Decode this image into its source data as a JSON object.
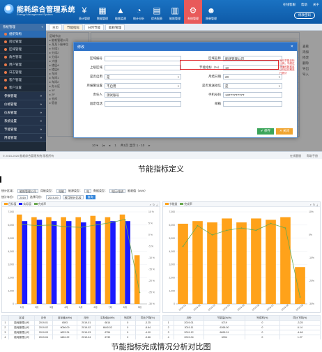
{
  "app": {
    "title": "能耗综合管理系统",
    "subtitle": "Energy Management System",
    "nav": [
      {
        "label": "表计管理",
        "icon": "¥"
      },
      {
        "label": "数据管理",
        "icon": "▦"
      },
      {
        "label": "能耗监测",
        "icon": "▲"
      },
      {
        "label": "统计分析",
        "icon": "◔"
      },
      {
        "label": "综合报表",
        "icon": "▤"
      },
      {
        "label": "能耗管理",
        "icon": "▥"
      },
      {
        "label": "系统管理",
        "icon": "⚙"
      },
      {
        "label": "隐患管理",
        "icon": "☻"
      }
    ],
    "active_nav": 6,
    "top_right": [
      "在线客服",
      "帮助",
      "关于"
    ],
    "change_password": "修改密码"
  },
  "sidebar": {
    "header": "系统管理",
    "items": [
      "组织架构",
      "岗位管理",
      "区域管理",
      "角色管理",
      "用户管理",
      "日志管理",
      "客户管理",
      "客户设置"
    ],
    "active": 0,
    "sections": [
      "参数管理",
      "价格管理",
      "仪表管理",
      "系统设置",
      "节能管理",
      "用能管理"
    ]
  },
  "tabs": [
    "主页",
    "节能指标",
    "分时节能",
    "能耗管理"
  ],
  "active_tab": 1,
  "tree": [
    "区域节点",
    "▸ 能耗管理公司",
    "  ▸ 某某下级单位",
    "    ▸ 分组1",
    "    ▸ 分组2",
    "    ▸ 分组3",
    "  ▸ 大楼",
    "    ▸ 楼层A",
    "    ▸ 楼层B",
    "  ▸ 车间",
    "    ▸ 车间1",
    "    ▸ 车间2",
    "  ▸ 办公区",
    "    ▸ 1F",
    "    ▸ 2F",
    "  ▸ 仓库",
    "  ▸ 宿舍"
  ],
  "right_pane": [
    "查看",
    "添加",
    "修改",
    "删除",
    "导出",
    "导入"
  ],
  "pager": {
    "page": "1",
    "text": "共1页 显示 1 - 10"
  },
  "footer": {
    "left": "© 2015-2020 能耗综合管理系统 版权所有",
    "right": [
      "在线客服",
      "帮助手册"
    ]
  },
  "modal": {
    "title": "修改",
    "fields_left": [
      {
        "label": "区域编号",
        "value": ""
      },
      {
        "label": "上级区域",
        "value": ""
      },
      {
        "label": "是否启用",
        "value": "是",
        "select": true
      },
      {
        "label": "月报警设置",
        "value": "不启用",
        "select": true
      },
      {
        "label": "责任人",
        "value": "测试账号"
      },
      {
        "label": "固定电话",
        "value": ""
      }
    ],
    "fields_right": [
      {
        "label": "区域名称",
        "value": "能耗管理公司"
      },
      {
        "label": "节能指标（%）",
        "value": "10"
      },
      {
        "label": "月结日期",
        "value": "20",
        "select": true
      },
      {
        "label": "是否发送短信",
        "value": "是",
        "select": true
      },
      {
        "label": "手机号码",
        "value": "13777777777"
      },
      {
        "label": "邮箱",
        "value": ""
      }
    ],
    "note": "每月节能目标比例；不超过此值的数据将以月结日期进行统计",
    "save": "保存",
    "close": "关闭"
  },
  "caption1": "节能指标定义",
  "caption2": "节能指标完成情况分析对比图",
  "filters": {
    "row1": [
      {
        "label": "统计区域：",
        "value": "能耗管理公司"
      },
      {
        "label": "用能类型：",
        "value": "电能"
      },
      {
        "label": "能源类型：",
        "value": "电"
      },
      {
        "label": "数据类型：",
        "value": "电压/电流"
      },
      {
        "label": "能耗值（kWh）",
        "value": ""
      }
    ],
    "row2": [
      {
        "label": "统计年份：",
        "value": "2019"
      },
      {
        "label": "选择月份：",
        "value": "2019-09"
      },
      {
        "label": "",
        "value": "按月统计比较"
      },
      {
        "label": "",
        "value": "查询"
      }
    ],
    "legend_left": [
      "目标值",
      "实际值",
      "完成率"
    ],
    "legend_right": [
      "节能量",
      "完成率"
    ]
  },
  "chart_data": [
    {
      "type": "bar",
      "categories": [
        "1月",
        "2月",
        "3月",
        "4月",
        "5月",
        "6月",
        "7月",
        "8月",
        "9月"
      ],
      "series": [
        {
          "name": "目标值",
          "values": [
            6800,
            6600,
            6600,
            6600,
            6600,
            6700,
            6600,
            6800,
            3700
          ]
        },
        {
          "name": "实际值",
          "values": [
            6300,
            6400,
            6300,
            6300,
            6200,
            6300,
            6300,
            6300,
            0
          ]
        },
        {
          "name": "完成率",
          "values": [
            4.5,
            4.1,
            4.3,
            3.5,
            3.3,
            4.3,
            5.3,
            6.7,
            -25
          ]
        }
      ],
      "ylim": [
        0,
        7000
      ],
      "y2lim": [
        -30,
        10
      ],
      "y_ticks": [
        "0",
        "1,000",
        "2,000",
        "3,000",
        "4,000",
        "5,000",
        "6,000",
        "7,000"
      ],
      "y2_ticks": [
        "-30 %",
        "-25 %",
        "-20 %",
        "-15 %",
        "-10 %",
        "-5 %",
        "0 %",
        "5 %",
        "10 %"
      ],
      "colors": [
        "#ffa21a",
        "#1a1aff",
        "#6aa84f"
      ]
    },
    {
      "type": "bar",
      "categories": [
        "2019-01",
        "2019-02",
        "2019-03",
        "2019-04",
        "2019-05",
        "2019-06",
        "2019-07",
        "2019-08",
        "2019-09"
      ],
      "series": [
        {
          "name": "节能量",
          "values": [
            6100,
            6300,
            6200,
            6500,
            6200,
            6500,
            6400,
            6600,
            2800
          ]
        },
        {
          "name": "完成率",
          "values": [
            -5,
            4,
            0,
            2,
            3,
            2,
            5,
            3,
            -27
          ]
        }
      ],
      "ylim": [
        0,
        7000
      ],
      "y2lim": [
        -30,
        10
      ],
      "y_ticks": [
        "0",
        "1,000",
        "2,000",
        "3,000",
        "4,000",
        "5,000",
        "6,000",
        "7,000"
      ],
      "y2_ticks": [
        "-30%",
        "-20%",
        "-10%",
        "0%",
        "10%"
      ],
      "colors": [
        "#ffa21a",
        "#6aa84f"
      ]
    }
  ],
  "table_left": {
    "headers": [
      "",
      "区域",
      "月份",
      "目标值(kWh)",
      "月份",
      "实际值(kWh)",
      "完成率",
      "同比下降(%)"
    ],
    "rows": [
      [
        "1",
        "能耗管理公司",
        "2019-01",
        "6593",
        "2019-01",
        "6814",
        "0",
        "-3.25"
      ],
      [
        "2",
        "能耗管理公司",
        "2019-02",
        "6066.09",
        "2019-02",
        "6640.02",
        "0",
        "-8.64"
      ],
      [
        "3",
        "能耗管理公司",
        "2019-03",
        "6623.24",
        "2019-03",
        "6754",
        "0",
        "-4.00"
      ],
      [
        "4",
        "能耗管理公司",
        "2019-04",
        "6481.22",
        "2019-04",
        "6732",
        "0",
        "-3.86"
      ]
    ]
  },
  "table_right": {
    "headers": [
      "",
      "月份",
      "节能量(kWh)",
      "完成率(%)",
      "同比下降(%)"
    ],
    "rows": [
      [
        "1",
        "2019-01",
        "6719",
        "0",
        "-3.25"
      ],
      [
        "2",
        "2019-11",
        "6268.00",
        "0",
        "6.14"
      ],
      [
        "3",
        "2019-12",
        "6895.01",
        "0",
        "-4.46"
      ],
      [
        "4",
        "2019-04",
        "6994",
        "0",
        "1.27"
      ]
    ]
  }
}
